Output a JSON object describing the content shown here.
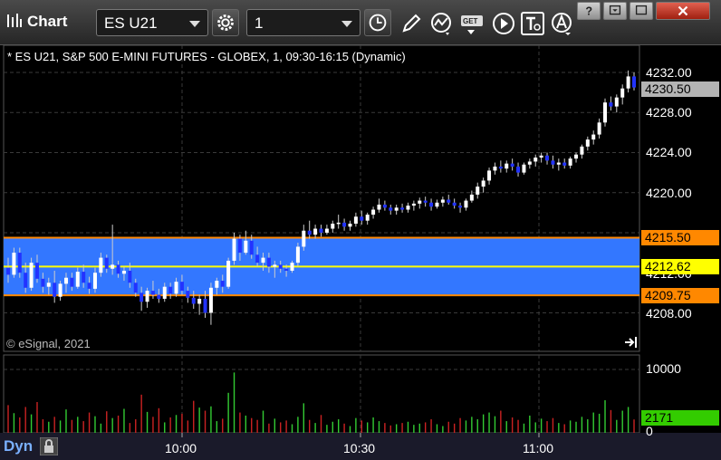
{
  "app": {
    "title": "Chart"
  },
  "toolbar": {
    "symbol": "ES U21",
    "interval": "1",
    "icons": [
      "settings-gear-icon",
      "clock-icon",
      "pencil-draw-icon",
      "studies-icon",
      "get-data-icon",
      "play-icon",
      "text-tool-icon",
      "alert-icon"
    ]
  },
  "window_controls": [
    "help-icon",
    "restore-icon",
    "minimize-icon",
    "close-icon"
  ],
  "chart": {
    "description": "* ES U21, S&P 500 E-MINI FUTURES - GLOBEX, 1, 09:30-16:15 (Dynamic)",
    "copyright": "© eSignal, 2021",
    "pane_label": "Dyn",
    "price_axis_labels": [
      "4232.00",
      "4228.00",
      "4224.00",
      "4220.00",
      "4212.00",
      "4208.00"
    ],
    "price_tags": {
      "last": "4230.50",
      "upper_band": "4215.50",
      "mid_line": "4212.62",
      "lower_band": "4209.75"
    },
    "volume_axis_labels": [
      "10000",
      "0"
    ],
    "volume_tag": "2171",
    "time_labels": [
      "10:00",
      "10:30",
      "11:00"
    ],
    "colors": {
      "band": "#3377ff",
      "band_border": "#ff8800",
      "mid_line": "#ffff00",
      "last_tag": "#aaaaaa",
      "volume_up": "#33cc33",
      "volume_down": "#cc2222",
      "volume_tag": "#33cc00"
    }
  },
  "chart_data": {
    "type": "candlestick",
    "y_range": [
      4205,
      4234
    ],
    "volume_range": [
      0,
      10000
    ],
    "band": {
      "upper": 4215.5,
      "mid": 4212.62,
      "lower": 4209.75
    },
    "bars": [
      [
        4212.5,
        4213.5,
        4211.0,
        4211.8,
        4500,
        "d"
      ],
      [
        4211.8,
        4214.5,
        4211.5,
        4214.0,
        3200,
        "u"
      ],
      [
        4214.0,
        4214.5,
        4211.5,
        4212.0,
        2500,
        "d"
      ],
      [
        4212.0,
        4213.0,
        4210.0,
        4210.5,
        4200,
        "d"
      ],
      [
        4210.5,
        4213.5,
        4210.2,
        4213.0,
        3000,
        "u"
      ],
      [
        4213.0,
        4213.8,
        4211.0,
        4211.4,
        5000,
        "d"
      ],
      [
        4211.4,
        4212.0,
        4210.0,
        4210.6,
        2200,
        "d"
      ],
      [
        4210.6,
        4211.5,
        4209.8,
        4211.0,
        1800,
        "u"
      ],
      [
        4211.0,
        4212.2,
        4209.0,
        4209.6,
        2600,
        "d"
      ],
      [
        4209.6,
        4211.2,
        4209.2,
        4210.9,
        2000,
        "u"
      ],
      [
        4210.9,
        4212.0,
        4210.0,
        4211.5,
        3800,
        "u"
      ],
      [
        4211.5,
        4212.0,
        4210.2,
        4210.6,
        2100,
        "d"
      ],
      [
        4210.6,
        4212.5,
        4210.4,
        4212.1,
        2600,
        "u"
      ],
      [
        4212.1,
        4212.8,
        4210.5,
        4211.0,
        1900,
        "d"
      ],
      [
        4211.0,
        4211.6,
        4209.9,
        4210.4,
        3300,
        "d"
      ],
      [
        4210.4,
        4212.5,
        4210.0,
        4212.0,
        2700,
        "u"
      ],
      [
        4212.0,
        4214.0,
        4211.6,
        4213.5,
        1500,
        "u"
      ],
      [
        4213.5,
        4213.8,
        4212.0,
        4212.4,
        3500,
        "d"
      ],
      [
        4212.4,
        4216.8,
        4211.8,
        4212.8,
        2400,
        "u"
      ],
      [
        4212.8,
        4213.2,
        4211.5,
        4211.9,
        2800,
        "d"
      ],
      [
        4211.9,
        4212.6,
        4211.2,
        4212.2,
        3900,
        "u"
      ],
      [
        4212.2,
        4213.0,
        4210.5,
        4211.0,
        1600,
        "d"
      ],
      [
        4211.0,
        4211.4,
        4209.6,
        4210.0,
        2200,
        "d"
      ],
      [
        4210.0,
        4210.6,
        4208.2,
        4209.1,
        6200,
        "d"
      ],
      [
        4209.1,
        4210.5,
        4208.5,
        4210.2,
        3400,
        "u"
      ],
      [
        4210.2,
        4211.2,
        4209.4,
        4209.8,
        2600,
        "d"
      ],
      [
        4209.8,
        4210.4,
        4209.0,
        4209.4,
        4000,
        "d"
      ],
      [
        4209.4,
        4211.0,
        4209.1,
        4210.6,
        1700,
        "u"
      ],
      [
        4210.6,
        4211.0,
        4209.4,
        4209.9,
        2500,
        "d"
      ],
      [
        4209.9,
        4211.5,
        4209.6,
        4211.1,
        2900,
        "u"
      ],
      [
        4211.1,
        4211.8,
        4209.8,
        4210.2,
        3100,
        "d"
      ],
      [
        4210.2,
        4210.6,
        4209.0,
        4209.5,
        2000,
        "d"
      ],
      [
        4209.5,
        4210.2,
        4208.4,
        4208.9,
        5200,
        "d"
      ],
      [
        4208.9,
        4209.8,
        4207.8,
        4209.4,
        4100,
        "u"
      ],
      [
        4209.4,
        4210.2,
        4207.5,
        4208.0,
        3600,
        "d"
      ],
      [
        4208.0,
        4211.0,
        4206.8,
        4210.5,
        4300,
        "u"
      ],
      [
        4210.5,
        4211.5,
        4209.8,
        4211.2,
        1900,
        "u"
      ],
      [
        4211.2,
        4211.8,
        4210.0,
        4210.6,
        2300,
        "d"
      ],
      [
        4210.6,
        4213.5,
        4210.4,
        4213.2,
        6500,
        "u"
      ],
      [
        4213.2,
        4216.0,
        4212.8,
        4215.4,
        9800,
        "u"
      ],
      [
        4215.4,
        4215.8,
        4213.2,
        4214.0,
        3300,
        "d"
      ],
      [
        4214.0,
        4216.2,
        4213.8,
        4215.2,
        2800,
        "u"
      ],
      [
        4215.2,
        4215.8,
        4213.4,
        4213.8,
        2400,
        "d"
      ],
      [
        4213.8,
        4214.6,
        4212.6,
        4213.0,
        2100,
        "d"
      ],
      [
        4213.0,
        4214.0,
        4212.2,
        4213.5,
        3600,
        "u"
      ],
      [
        4213.5,
        4214.0,
        4212.0,
        4212.6,
        1500,
        "d"
      ],
      [
        4212.6,
        4213.2,
        4211.5,
        4212.8,
        2300,
        "u"
      ],
      [
        4212.8,
        4213.2,
        4212.0,
        4212.4,
        1700,
        "d"
      ],
      [
        4212.4,
        4212.8,
        4211.6,
        4212.2,
        2000,
        "d"
      ],
      [
        4212.2,
        4213.2,
        4212.0,
        4213.0,
        1400,
        "u"
      ],
      [
        4213.0,
        4215.0,
        4212.6,
        4214.6,
        2600,
        "u"
      ],
      [
        4214.6,
        4216.8,
        4214.2,
        4216.2,
        4800,
        "u"
      ],
      [
        4216.2,
        4217.2,
        4215.4,
        4215.8,
        2100,
        "d"
      ],
      [
        4215.8,
        4216.8,
        4215.4,
        4216.4,
        1600,
        "u"
      ],
      [
        4216.4,
        4216.8,
        4215.6,
        4216.0,
        2900,
        "d"
      ],
      [
        4216.0,
        4216.8,
        4215.8,
        4216.4,
        1300,
        "u"
      ],
      [
        4216.4,
        4217.2,
        4216.0,
        4216.9,
        1800,
        "u"
      ],
      [
        4216.9,
        4217.8,
        4216.4,
        4217.0,
        2200,
        "u"
      ],
      [
        4217.0,
        4217.4,
        4216.2,
        4216.6,
        1500,
        "d"
      ],
      [
        4216.6,
        4217.2,
        4216.2,
        4216.9,
        1100,
        "u"
      ],
      [
        4216.9,
        4218.0,
        4216.6,
        4217.6,
        2400,
        "u"
      ],
      [
        4217.6,
        4218.2,
        4216.8,
        4217.2,
        2000,
        "d"
      ],
      [
        4217.2,
        4218.0,
        4216.8,
        4217.8,
        1700,
        "u"
      ],
      [
        4217.8,
        4218.6,
        4217.4,
        4218.3,
        2500,
        "u"
      ],
      [
        4218.3,
        4219.4,
        4218.0,
        4218.8,
        1900,
        "u"
      ],
      [
        4218.8,
        4219.2,
        4218.2,
        4218.5,
        1600,
        "d"
      ],
      [
        4218.5,
        4218.8,
        4217.8,
        4218.2,
        1200,
        "d"
      ],
      [
        4218.2,
        4218.8,
        4217.8,
        4218.5,
        1400,
        "u"
      ],
      [
        4218.5,
        4218.9,
        4218.0,
        4218.3,
        1600,
        "d"
      ],
      [
        4218.3,
        4219.0,
        4218.0,
        4218.7,
        1800,
        "u"
      ],
      [
        4218.7,
        4219.2,
        4218.2,
        4218.9,
        1300,
        "u"
      ],
      [
        4218.9,
        4219.5,
        4218.4,
        4219.2,
        1500,
        "u"
      ],
      [
        4219.2,
        4219.6,
        4218.6,
        4219.0,
        1700,
        "d"
      ],
      [
        4219.0,
        4219.4,
        4218.2,
        4218.6,
        2200,
        "d"
      ],
      [
        4218.6,
        4219.3,
        4218.4,
        4219.0,
        1400,
        "u"
      ],
      [
        4219.0,
        4219.6,
        4218.6,
        4219.3,
        1100,
        "u"
      ],
      [
        4219.3,
        4219.8,
        4218.8,
        4219.0,
        1800,
        "d"
      ],
      [
        4219.0,
        4219.4,
        4218.4,
        4218.7,
        1500,
        "d"
      ],
      [
        4218.7,
        4219.0,
        4218.0,
        4218.5,
        2400,
        "d"
      ],
      [
        4218.5,
        4219.4,
        4218.2,
        4219.2,
        2000,
        "u"
      ],
      [
        4219.2,
        4220.2,
        4219.0,
        4219.8,
        2600,
        "u"
      ],
      [
        4219.8,
        4221.0,
        4219.4,
        4220.6,
        2200,
        "u"
      ],
      [
        4220.6,
        4221.5,
        4220.0,
        4221.2,
        3000,
        "u"
      ],
      [
        4221.2,
        4222.5,
        4220.8,
        4222.2,
        3300,
        "u"
      ],
      [
        4222.2,
        4223.0,
        4221.8,
        4222.6,
        2700,
        "u"
      ],
      [
        4222.6,
        4223.2,
        4222.0,
        4222.4,
        3600,
        "d"
      ],
      [
        4222.4,
        4223.2,
        4222.0,
        4222.9,
        1900,
        "u"
      ],
      [
        4222.9,
        4223.4,
        4222.2,
        4222.6,
        2500,
        "d"
      ],
      [
        4222.6,
        4223.0,
        4221.6,
        4222.0,
        2100,
        "d"
      ],
      [
        4222.0,
        4223.0,
        4221.8,
        4222.8,
        1500,
        "u"
      ],
      [
        4222.8,
        4223.4,
        4222.4,
        4223.1,
        2800,
        "u"
      ],
      [
        4223.1,
        4223.8,
        4222.6,
        4223.5,
        1700,
        "u"
      ],
      [
        4223.5,
        4224.0,
        4223.0,
        4223.7,
        2300,
        "u"
      ],
      [
        4223.7,
        4224.0,
        4222.8,
        4223.2,
        1900,
        "d"
      ],
      [
        4223.2,
        4223.7,
        4222.4,
        4222.8,
        2400,
        "d"
      ],
      [
        4222.8,
        4223.4,
        4222.2,
        4223.0,
        1600,
        "u"
      ],
      [
        4223.0,
        4223.4,
        4222.4,
        4222.7,
        1400,
        "d"
      ],
      [
        4222.7,
        4223.6,
        4222.4,
        4223.4,
        2000,
        "u"
      ],
      [
        4223.4,
        4224.0,
        4223.0,
        4223.8,
        1800,
        "u"
      ],
      [
        4223.8,
        4224.8,
        4223.4,
        4224.6,
        2600,
        "u"
      ],
      [
        4224.6,
        4225.6,
        4224.2,
        4225.3,
        2200,
        "u"
      ],
      [
        4225.3,
        4226.2,
        4224.8,
        4225.8,
        3300,
        "u"
      ],
      [
        4225.8,
        4227.4,
        4225.4,
        4227.0,
        3100,
        "u"
      ],
      [
        4227.0,
        4229.4,
        4226.6,
        4229.0,
        5300,
        "u"
      ],
      [
        4229.0,
        4229.6,
        4228.2,
        4228.6,
        3700,
        "d"
      ],
      [
        4228.6,
        4229.8,
        4228.0,
        4229.5,
        2100,
        "u"
      ],
      [
        4229.5,
        4230.8,
        4228.8,
        4230.4,
        3600,
        "u"
      ],
      [
        4230.4,
        4232.2,
        4230.0,
        4231.6,
        4200,
        "u"
      ],
      [
        4231.6,
        4232.0,
        4230.2,
        4230.5,
        2171,
        "d"
      ]
    ]
  }
}
